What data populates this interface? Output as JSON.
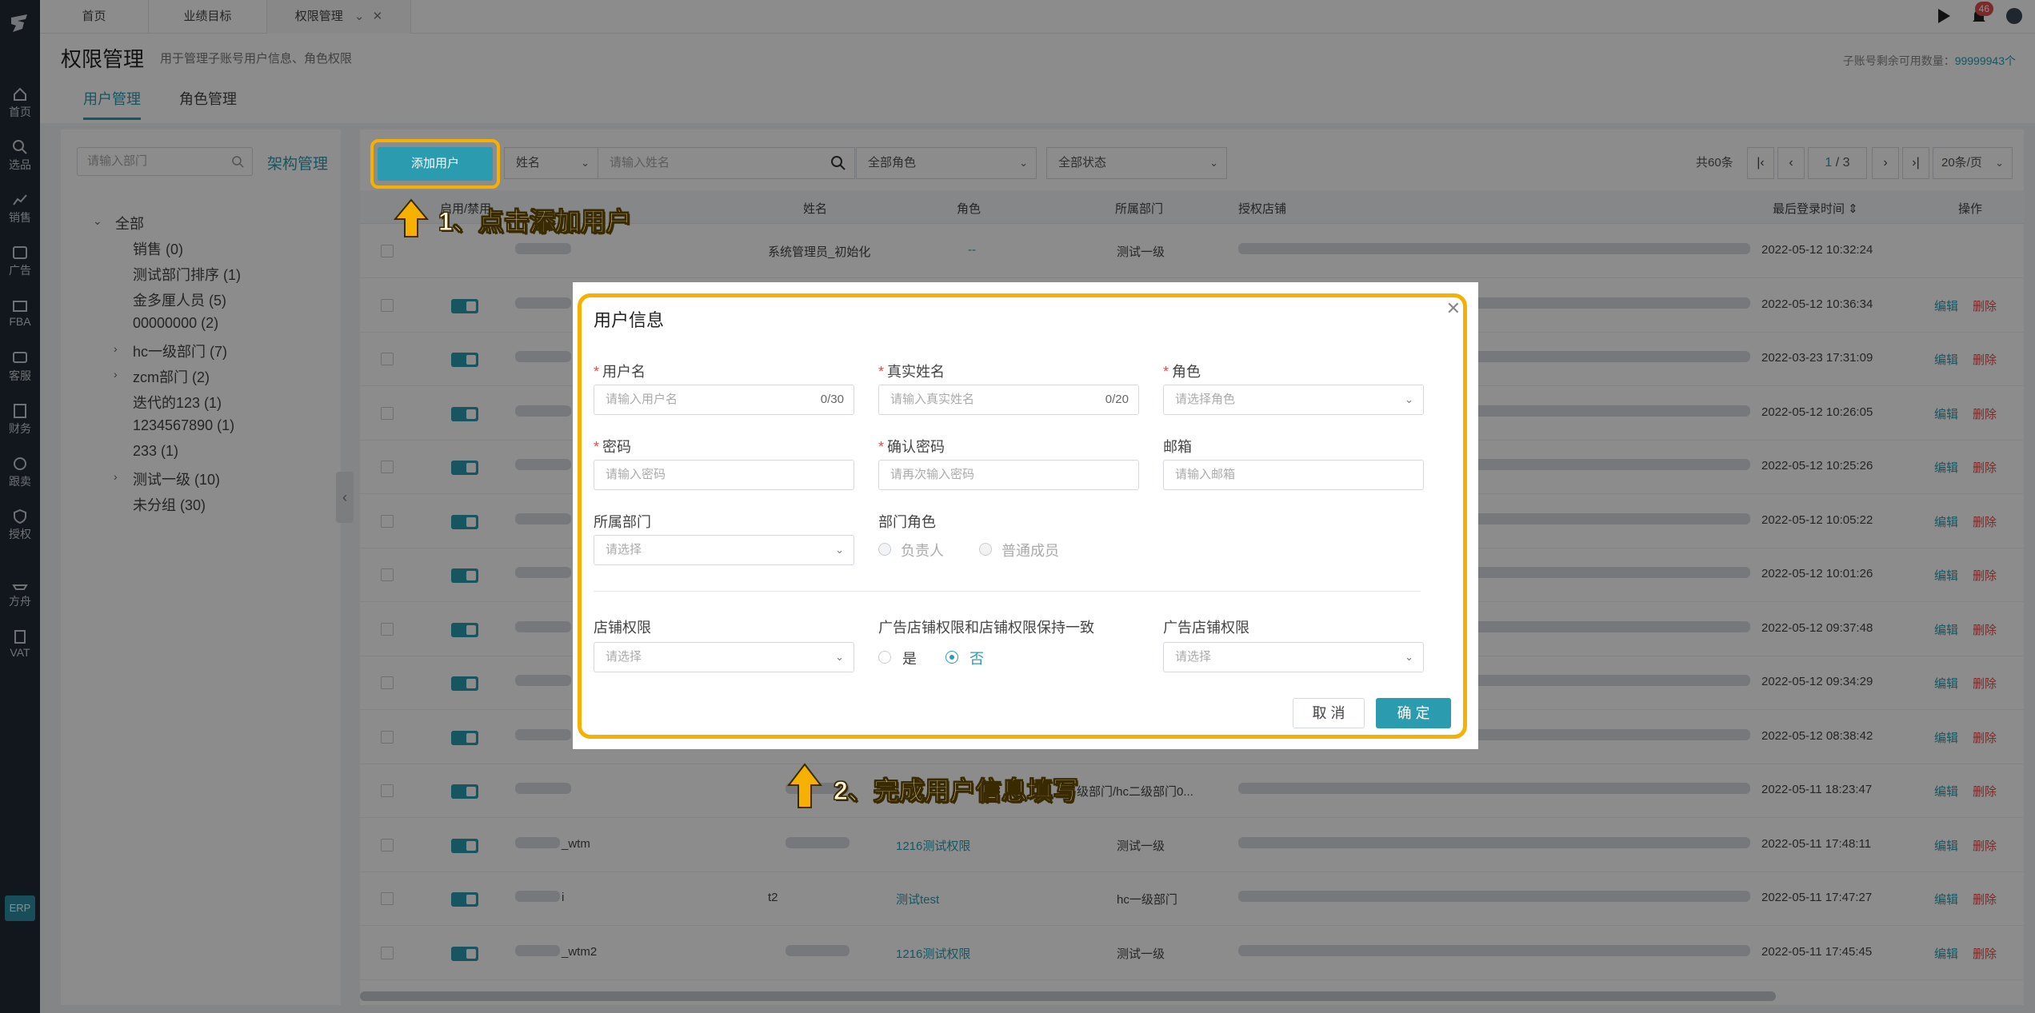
{
  "nav": {
    "items": [
      "首页",
      "选品",
      "销售",
      "广告",
      "FBA",
      "客服",
      "财务",
      "跟卖",
      "授权",
      "方舟",
      "VAT"
    ],
    "erp": "ERP"
  },
  "tabs": [
    "首页",
    "业绩目标",
    "权限管理"
  ],
  "notifications": "46",
  "page": {
    "title": "权限管理",
    "subtitle": "用于管理子账号用户信息、角色权限",
    "quota_label": "子账号剩余可用数量：",
    "quota_value": "99999943个",
    "subtabs": [
      "用户管理",
      "角色管理"
    ]
  },
  "dept": {
    "search_placeholder": "请输入部门",
    "manage": "架构管理",
    "tree": [
      {
        "label": "全部",
        "caret": "down"
      },
      {
        "label": "销售  (0)"
      },
      {
        "label": "测试部门排序  (1)"
      },
      {
        "label": "金多厘人员  (5)"
      },
      {
        "label": "00000000  (2)"
      },
      {
        "label": "hc一级部门  (7)",
        "caret": "right"
      },
      {
        "label": "zcm部门  (2)",
        "caret": "right"
      },
      {
        "label": "迭代的123  (1)"
      },
      {
        "label": "1234567890  (1)"
      },
      {
        "label": "233  (1)"
      },
      {
        "label": "测试一级  (10)",
        "caret": "right"
      },
      {
        "label": "未分组  (30)"
      }
    ]
  },
  "toolbar": {
    "add_user": "添加用户",
    "name_select": "姓名",
    "name_placeholder": "请输入姓名",
    "role_select": "全部角色",
    "status_select": "全部状态",
    "total": "共60条",
    "page_current": "1",
    "page_total": "/ 3",
    "per_page": "20条/页"
  },
  "table": {
    "headers": [
      "启用/禁用",
      "姓名",
      "角色",
      "所属部门",
      "授权店铺",
      "最后登录时间",
      "操作"
    ],
    "edit": "编辑",
    "delete": "删除",
    "rows": [
      {
        "name": "系统管理员_初始化",
        "role": "--",
        "dept": "测试一级",
        "time": "2022-05-12 10:32:24",
        "toggle": false,
        "actions": false
      },
      {
        "name": "",
        "role": "",
        "dept": "",
        "time": "2022-05-12 10:36:34",
        "toggle": true,
        "actions": true
      },
      {
        "name": "",
        "role": "",
        "dept": "",
        "time": "2022-03-23 17:31:09",
        "toggle": true,
        "actions": true
      },
      {
        "name": "",
        "role": "",
        "dept": "",
        "time": "2022-05-12 10:26:05",
        "toggle": true,
        "actions": true
      },
      {
        "name": "",
        "role": "",
        "dept": "",
        "time": "2022-05-12 10:25:26",
        "toggle": true,
        "actions": true
      },
      {
        "name": "",
        "role": "",
        "dept": "",
        "time": "2022-05-12 10:05:22",
        "toggle": true,
        "actions": true
      },
      {
        "name": "",
        "role": "",
        "dept": "",
        "time": "2022-05-12 10:01:26",
        "toggle": true,
        "actions": true
      },
      {
        "name": "",
        "role": "",
        "dept": "",
        "time": "2022-05-12 09:37:48",
        "toggle": true,
        "actions": true
      },
      {
        "name": "",
        "role": "",
        "dept": "",
        "time": "2022-05-12 09:34:29",
        "toggle": true,
        "actions": true
      },
      {
        "name": "",
        "role": "",
        "dept": "",
        "time": "2022-05-12 08:38:42",
        "toggle": true,
        "actions": true
      },
      {
        "name": "",
        "role": "",
        "dept": "级部门/hc二级部门0...",
        "time": "2022-05-11 18:23:47",
        "toggle": true,
        "actions": true
      },
      {
        "user": "_wtm",
        "name": "",
        "role": "1216测试权限",
        "dept": "测试一级",
        "time": "2022-05-11 17:48:11",
        "toggle": true,
        "actions": true
      },
      {
        "user": "i",
        "name": "t2",
        "role": "测试test",
        "dept": "hc一级部门",
        "time": "2022-05-11 17:47:27",
        "toggle": true,
        "actions": true
      },
      {
        "user": "_wtm2",
        "name": "",
        "role": "1216测试权限",
        "dept": "测试一级",
        "time": "2022-05-11 17:45:45",
        "toggle": true,
        "actions": true
      }
    ]
  },
  "modal": {
    "title": "用户信息",
    "username_label": "用户名",
    "username_placeholder": "请输入用户名",
    "username_count": "0/30",
    "realname_label": "真实姓名",
    "realname_placeholder": "请输入真实姓名",
    "realname_count": "0/20",
    "role_label": "角色",
    "role_placeholder": "请选择角色",
    "password_label": "密码",
    "password_placeholder": "请输入密码",
    "confirm_label": "确认密码",
    "confirm_placeholder": "请再次输入密码",
    "email_label": "邮箱",
    "email_placeholder": "请输入邮箱",
    "dept_label": "所属部门",
    "dept_placeholder": "请选择",
    "dept_role_label": "部门角色",
    "dept_role_opt1": "负责人",
    "dept_role_opt2": "普通成员",
    "shop_label": "店铺权限",
    "shop_placeholder": "请选择",
    "sync_label": "广告店铺权限和店铺权限保持一致",
    "sync_yes": "是",
    "sync_no": "否",
    "ad_shop_label": "广告店铺权限",
    "ad_shop_placeholder": "请选择",
    "cancel": "取 消",
    "ok": "确 定"
  },
  "callouts": {
    "step1": "1、点击添加用户",
    "step2": "2、完成用户信息填写"
  },
  "colors": {
    "accent": "#2b9cb0",
    "highlight": "#f5b000",
    "danger": "#e04b4b"
  }
}
